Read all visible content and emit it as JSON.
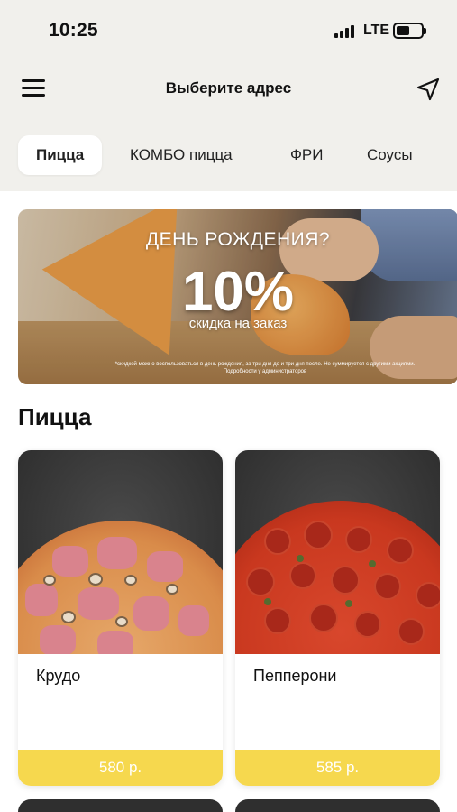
{
  "status_bar": {
    "time": "10:25",
    "network": "LTE"
  },
  "header": {
    "title": "Выберите адрес"
  },
  "tabs": [
    {
      "label": "Пицца",
      "active": true
    },
    {
      "label": "КОМБО пицца",
      "active": false
    },
    {
      "label": "ФРИ",
      "active": false
    },
    {
      "label": "Соусы",
      "active": false
    }
  ],
  "banner": {
    "title": "ДЕНЬ РОЖДЕНИЯ?",
    "percent": "10%",
    "subtitle": "скидка на заказ",
    "fine_print": "*скидкой можно воспользоваться в день рождения, за три дня до и три дня после. Не суммируется с другими акциями. Подробности у администраторов"
  },
  "section": {
    "title": "Пицца"
  },
  "products": [
    {
      "name": "Крудо",
      "price": "580 р."
    },
    {
      "name": "Пепперони",
      "price": "585 р."
    }
  ],
  "colors": {
    "top_background": "#f1f0ec",
    "price_bar": "#f6d84e",
    "card_photo_background": "#2f2f2f"
  }
}
